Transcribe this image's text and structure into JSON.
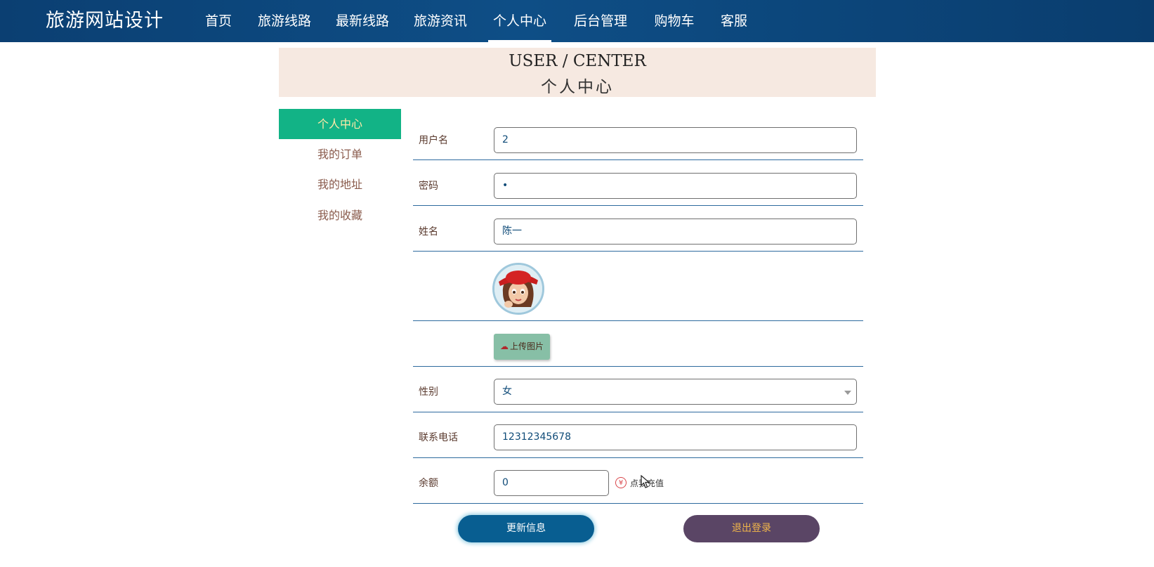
{
  "header": {
    "brand": "旅游网站设计",
    "nav": [
      {
        "label": "首页"
      },
      {
        "label": "旅游线路"
      },
      {
        "label": "最新线路"
      },
      {
        "label": "旅游资讯"
      },
      {
        "label": "个人中心",
        "active": true
      },
      {
        "label": "后台管理"
      },
      {
        "label": "购物车"
      },
      {
        "label": "客服"
      }
    ]
  },
  "banner": {
    "title_en": "USER / CENTER",
    "title_cn": "个人中心"
  },
  "sidebar": {
    "items": [
      {
        "label": "个人中心",
        "active": true
      },
      {
        "label": "我的订单"
      },
      {
        "label": "我的地址"
      },
      {
        "label": "我的收藏"
      }
    ]
  },
  "form": {
    "username": {
      "label": "用户名",
      "value": "2"
    },
    "password": {
      "label": "密码",
      "value": "•"
    },
    "name": {
      "label": "姓名",
      "value": "陈一"
    },
    "upload": {
      "label": "上传图片"
    },
    "gender": {
      "label": "性别",
      "value": "女"
    },
    "phone": {
      "label": "联系电话",
      "value": "12312345678"
    },
    "balance": {
      "label": "余额",
      "value": "0",
      "recharge_label": "点我充值",
      "currency_symbol": "¥"
    }
  },
  "actions": {
    "update_label": "更新信息",
    "logout_label": "退出登录"
  },
  "colors": {
    "nav_bg": "#0e4e86",
    "sidebar_active": "#12b386",
    "banner_bg": "#f6e9e1",
    "update_btn": "#085e91",
    "logout_btn": "#5a4565"
  }
}
